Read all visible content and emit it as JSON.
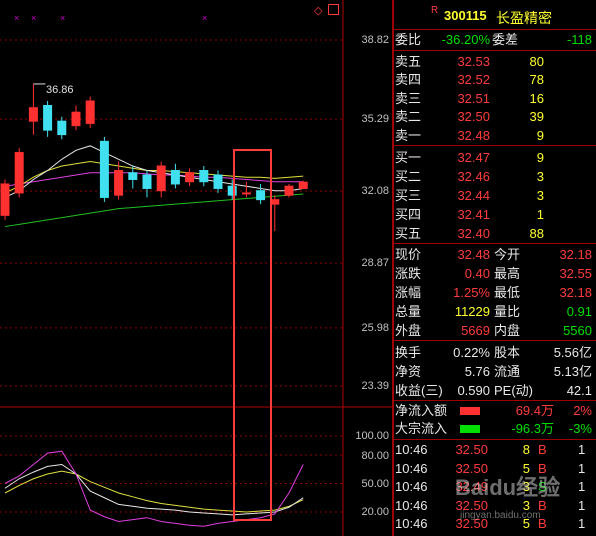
{
  "stock": {
    "code": "300115",
    "name": "长盈精密",
    "flag": "R"
  },
  "chart": {
    "price_axis": [
      {
        "label": "38.82",
        "value": 38.82
      },
      {
        "label": "35.29",
        "value": 35.29
      },
      {
        "label": "32.08",
        "value": 32.08
      },
      {
        "label": "28.87",
        "value": 28.87
      },
      {
        "label": "25.98",
        "value": 25.98
      },
      {
        "label": "23.39",
        "value": 23.39
      }
    ],
    "ind_axis": [
      {
        "label": "100.00",
        "value": 100
      },
      {
        "label": "80.00",
        "value": 80
      },
      {
        "label": "50.00",
        "value": 50
      },
      {
        "label": "20.00",
        "value": 20
      }
    ],
    "peak_label": "36.86",
    "markers": [
      "×",
      "×",
      "×",
      "×"
    ],
    "candles": [
      {
        "o": 31.0,
        "c": 32.4,
        "h": 32.6,
        "l": 30.8
      },
      {
        "o": 32.0,
        "c": 33.8,
        "h": 34.0,
        "l": 31.8
      },
      {
        "o": 35.2,
        "c": 35.8,
        "h": 36.86,
        "l": 34.6
      },
      {
        "o": 35.9,
        "c": 34.8,
        "h": 36.1,
        "l": 34.5
      },
      {
        "o": 35.2,
        "c": 34.6,
        "h": 35.4,
        "l": 34.4
      },
      {
        "o": 35.0,
        "c": 35.6,
        "h": 35.9,
        "l": 34.8
      },
      {
        "o": 35.1,
        "c": 36.1,
        "h": 36.3,
        "l": 34.9
      },
      {
        "o": 34.3,
        "c": 31.8,
        "h": 34.5,
        "l": 31.6
      },
      {
        "o": 31.9,
        "c": 33.0,
        "h": 33.4,
        "l": 31.7
      },
      {
        "o": 32.9,
        "c": 32.6,
        "h": 33.2,
        "l": 32.2
      },
      {
        "o": 32.8,
        "c": 32.2,
        "h": 33.0,
        "l": 31.8
      },
      {
        "o": 32.1,
        "c": 33.2,
        "h": 33.4,
        "l": 31.8
      },
      {
        "o": 33.0,
        "c": 32.4,
        "h": 33.3,
        "l": 32.2
      },
      {
        "o": 32.5,
        "c": 32.9,
        "h": 33.1,
        "l": 32.3
      },
      {
        "o": 33.0,
        "c": 32.5,
        "h": 33.2,
        "l": 32.3
      },
      {
        "o": 32.8,
        "c": 32.2,
        "h": 33.0,
        "l": 32.0
      },
      {
        "o": 32.3,
        "c": 31.9,
        "h": 32.6,
        "l": 31.7
      },
      {
        "o": 32.0,
        "c": 32.0,
        "h": 32.5,
        "l": 31.8
      },
      {
        "o": 32.1,
        "c": 31.7,
        "h": 32.4,
        "l": 31.5
      },
      {
        "o": 31.5,
        "c": 31.7,
        "h": 31.9,
        "l": 30.3
      },
      {
        "o": 31.9,
        "c": 32.3,
        "h": 32.4,
        "l": 31.8
      },
      {
        "o": 32.2,
        "c": 32.48,
        "h": 32.55,
        "l": 32.18
      }
    ],
    "ma_white": [
      31.8,
      32.1,
      32.6,
      33.0,
      33.5,
      33.9,
      34.1,
      33.8,
      33.5,
      33.2,
      33.0,
      32.9,
      32.8,
      32.7,
      32.6,
      32.5,
      32.4,
      32.3,
      32.2,
      32.1,
      32.1,
      32.2
    ],
    "ma_yellow": [
      32.0,
      32.3,
      32.7,
      33.0,
      33.2,
      33.3,
      33.4,
      33.3,
      33.2,
      33.1,
      33.0,
      33.0,
      32.95,
      32.9,
      32.85,
      32.8,
      32.75,
      32.7,
      32.7,
      32.65,
      32.7,
      32.75
    ],
    "ma_magenta": [
      32.3,
      32.4,
      32.5,
      32.6,
      32.7,
      32.8,
      32.9,
      32.9,
      32.9,
      32.9,
      32.85,
      32.8,
      32.8,
      32.75,
      32.7,
      32.7,
      32.65,
      32.6,
      32.55,
      32.5,
      32.5,
      32.5
    ],
    "ma_green": [
      30.5,
      30.6,
      30.7,
      30.8,
      30.9,
      31.0,
      31.1,
      31.2,
      31.3,
      31.35,
      31.4,
      31.45,
      31.5,
      31.55,
      31.6,
      31.65,
      31.7,
      31.75,
      31.8,
      31.85,
      31.9,
      31.95
    ],
    "k_line": [
      45,
      55,
      62,
      68,
      70,
      60,
      42,
      35,
      28,
      26,
      24,
      23,
      22,
      20,
      19,
      18,
      17,
      18,
      19,
      20,
      25,
      35
    ],
    "d_line": [
      40,
      48,
      55,
      60,
      63,
      60,
      52,
      46,
      40,
      36,
      32,
      29,
      27,
      25,
      23,
      22,
      21,
      20,
      21,
      22,
      26,
      33
    ],
    "j_line": [
      50,
      58,
      70,
      82,
      84,
      60,
      22,
      15,
      10,
      12,
      14,
      10,
      8,
      6,
      5,
      8,
      10,
      12,
      14,
      18,
      40,
      70
    ]
  },
  "order_book": {
    "weibi": {
      "label": "委比",
      "value": "-36.20%",
      "diff_label": "委差",
      "diff": "-118"
    },
    "asks": [
      {
        "label": "卖五",
        "price": "32.53",
        "vol": "80"
      },
      {
        "label": "卖四",
        "price": "32.52",
        "vol": "78"
      },
      {
        "label": "卖三",
        "price": "32.51",
        "vol": "16"
      },
      {
        "label": "卖二",
        "price": "32.50",
        "vol": "39"
      },
      {
        "label": "卖一",
        "price": "32.48",
        "vol": "9"
      }
    ],
    "bids": [
      {
        "label": "买一",
        "price": "32.47",
        "vol": "9"
      },
      {
        "label": "买二",
        "price": "32.46",
        "vol": "3"
      },
      {
        "label": "买三",
        "price": "32.44",
        "vol": "3"
      },
      {
        "label": "买四",
        "price": "32.41",
        "vol": "1"
      },
      {
        "label": "买五",
        "price": "32.40",
        "vol": "88"
      }
    ]
  },
  "quote": [
    {
      "l1": "现价",
      "v1": "32.48",
      "l2": "今开",
      "v2": "32.18"
    },
    {
      "l1": "涨跌",
      "v1": "0.40",
      "l2": "最高",
      "v2": "32.55"
    },
    {
      "l1": "涨幅",
      "v1": "1.25%",
      "l2": "最低",
      "v2": "32.18"
    },
    {
      "l1": "总量",
      "v1": "11229",
      "l2": "量比",
      "v2": "0.91"
    },
    {
      "l1": "外盘",
      "v1": "5669",
      "l2": "内盘",
      "v2": "5560"
    }
  ],
  "stats": [
    {
      "l1": "换手",
      "v1": "0.22%",
      "l2": "股本",
      "v2": "5.56亿"
    },
    {
      "l1": "净资",
      "v1": "5.76",
      "l2": "流通",
      "v2": "5.13亿"
    },
    {
      "l1": "收益(三)",
      "v1": "0.590",
      "l2": "PE(动)",
      "v2": "42.1"
    }
  ],
  "flow": [
    {
      "label": "净流入额",
      "value": "69.4万",
      "pct": "2%",
      "bar_color": "#ff3030"
    },
    {
      "label": "大宗流入",
      "value": "-96.3万",
      "pct": "-3%",
      "bar_color": "#00e000"
    }
  ],
  "ticks": [
    {
      "time": "10:46",
      "price": "32.50",
      "vol": "8",
      "side": "B",
      "n": "1"
    },
    {
      "time": "10:46",
      "price": "32.50",
      "vol": "5",
      "side": "B",
      "n": "1"
    },
    {
      "time": "10:46",
      "price": "32.49",
      "vol": "3",
      "side": "S",
      "n": "1"
    },
    {
      "time": "10:46",
      "price": "32.50",
      "vol": "3",
      "side": "B",
      "n": "1"
    },
    {
      "time": "10:46",
      "price": "32.50",
      "vol": "5",
      "side": "B",
      "n": "1"
    }
  ],
  "watermark": {
    "text": "Baidu经验",
    "sub": "jingyan.baidu.com"
  }
}
